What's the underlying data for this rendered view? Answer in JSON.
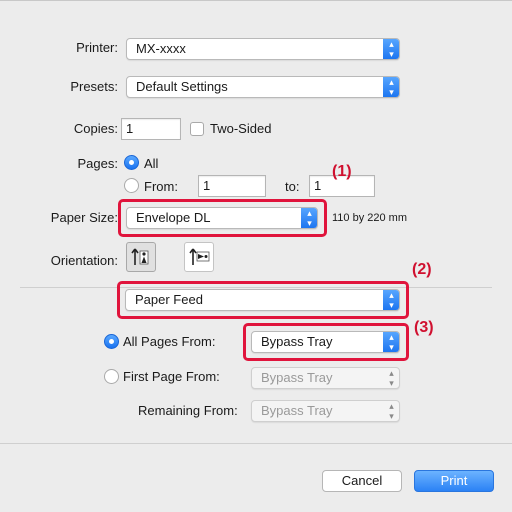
{
  "printer": {
    "label": "Printer:",
    "value": "MX-xxxx"
  },
  "presets": {
    "label": "Presets:",
    "value": "Default Settings"
  },
  "copies": {
    "label": "Copies:",
    "value": "1",
    "two_sided_label": "Two-Sided"
  },
  "pages": {
    "label": "Pages:",
    "all_label": "All",
    "from_label": "From:",
    "from_value": "1",
    "to_label": "to:",
    "to_value": "1"
  },
  "paper_size": {
    "label": "Paper Size:",
    "value": "Envelope DL",
    "dimensions": "110 by 220 mm"
  },
  "orientation": {
    "label": "Orientation:"
  },
  "section_popup": {
    "value": "Paper Feed"
  },
  "paper_feed": {
    "all_pages_label": "All Pages From:",
    "all_pages_value": "Bypass Tray",
    "first_page_label": "First Page From:",
    "first_page_value": "Bypass Tray",
    "remaining_label": "Remaining From:",
    "remaining_value": "Bypass Tray"
  },
  "buttons": {
    "cancel": "Cancel",
    "print": "Print"
  },
  "callouts": {
    "c1": "(1)",
    "c2": "(2)",
    "c3": "(3)"
  },
  "colors": {
    "highlight": "#e0143c",
    "accent": "#1a73f0"
  }
}
